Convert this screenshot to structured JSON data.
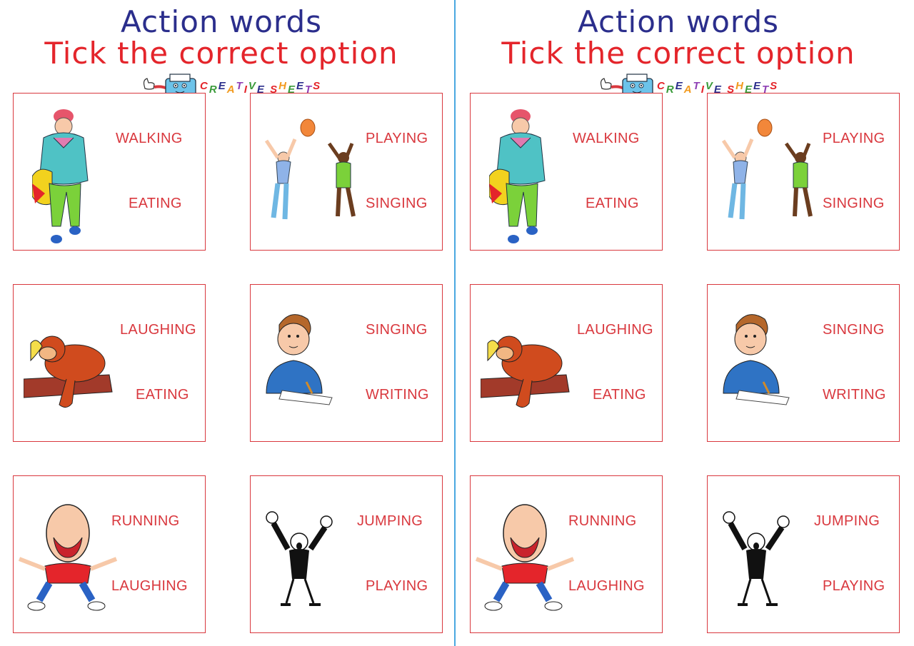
{
  "sheets": [
    {
      "title_line1": "Action words",
      "title_line2": "Tick the correct option",
      "logo_text": [
        "C",
        "R",
        "E",
        "A",
        "T",
        "I",
        "V",
        "E",
        " ",
        "S",
        "H",
        "E",
        "E",
        "T",
        "S"
      ],
      "cards": [
        {
          "picture": "walking-child-icon",
          "option_1": "WALKING",
          "option_2": "EATING"
        },
        {
          "picture": "kids-playing-ball-icon",
          "option_1": "PLAYING",
          "option_2": "SINGING"
        },
        {
          "picture": "monkey-eating-banana-icon",
          "option_1": "LAUGHING",
          "option_2": "EATING"
        },
        {
          "picture": "boy-writing-icon",
          "option_1": "SINGING",
          "option_2": "WRITING"
        },
        {
          "picture": "laughing-boy-icon",
          "option_1": "RUNNING",
          "option_2": "LAUGHING"
        },
        {
          "picture": "man-jumping-icon",
          "option_1": "JUMPING",
          "option_2": "PLAYING"
        }
      ]
    },
    {
      "title_line1": "Action words",
      "title_line2": "Tick the correct option",
      "logo_text": [
        "C",
        "R",
        "E",
        "A",
        "T",
        "I",
        "V",
        "E",
        " ",
        "S",
        "H",
        "E",
        "E",
        "T",
        "S"
      ],
      "cards": [
        {
          "picture": "walking-child-icon",
          "option_1": "WALKING",
          "option_2": "EATING"
        },
        {
          "picture": "kids-playing-ball-icon",
          "option_1": "PLAYING",
          "option_2": "SINGING"
        },
        {
          "picture": "monkey-eating-banana-icon",
          "option_1": "LAUGHING",
          "option_2": "EATING"
        },
        {
          "picture": "boy-writing-icon",
          "option_1": "SINGING",
          "option_2": "WRITING"
        },
        {
          "picture": "laughing-boy-icon",
          "option_1": "RUNNING",
          "option_2": "LAUGHING"
        },
        {
          "picture": "man-jumping-icon",
          "option_1": "JUMPING",
          "option_2": "PLAYING"
        }
      ]
    }
  ],
  "colors": {
    "title_blue": "#2b2e8c",
    "title_red": "#e4252b",
    "option_red": "#d9383e",
    "divider": "#4aa8e0",
    "logo_letters": [
      "#e4252b",
      "#3a9b3a",
      "#2b2e8c",
      "#f29a1e",
      "#8e3fb5",
      "#e4252b",
      "#3a9b3a",
      "#2b2e8c",
      "#ffffff",
      "#e4252b",
      "#f29a1e",
      "#3a9b3a",
      "#2b2e8c",
      "#8e3fb5",
      "#e4252b"
    ]
  }
}
